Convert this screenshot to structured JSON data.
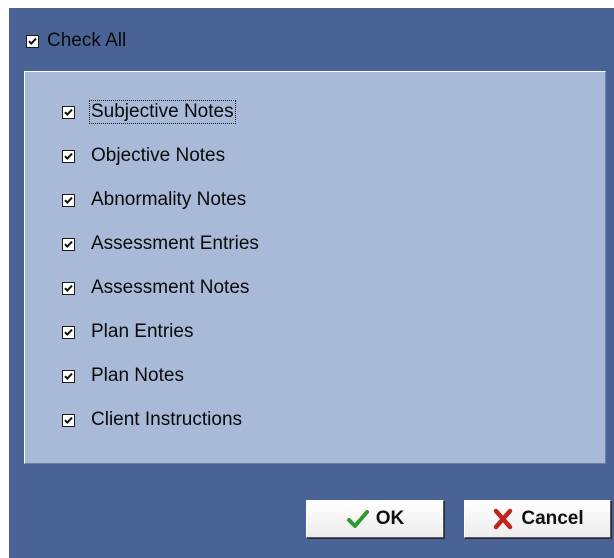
{
  "dialog": {
    "check_all": {
      "label": "Check All",
      "checked": true
    },
    "items": [
      {
        "label": "Subjective Notes",
        "checked": true,
        "focused": true
      },
      {
        "label": "Objective Notes",
        "checked": true
      },
      {
        "label": "Abnormality Notes",
        "checked": true
      },
      {
        "label": "Assessment Entries",
        "checked": true
      },
      {
        "label": "Assessment Notes",
        "checked": true
      },
      {
        "label": "Plan Entries",
        "checked": true
      },
      {
        "label": "Plan Notes",
        "checked": true
      },
      {
        "label": "Client Instructions",
        "checked": true
      }
    ],
    "buttons": {
      "ok_label": "OK",
      "cancel_label": "Cancel"
    },
    "icons": {
      "ok": "green-checkmark-icon",
      "cancel": "red-x-icon"
    },
    "colors": {
      "dialog_bg": "#4a6396",
      "panel_bg": "#a9b9d8",
      "ok_icon": "#2e9b2e",
      "cancel_icon": "#c0241c"
    }
  }
}
